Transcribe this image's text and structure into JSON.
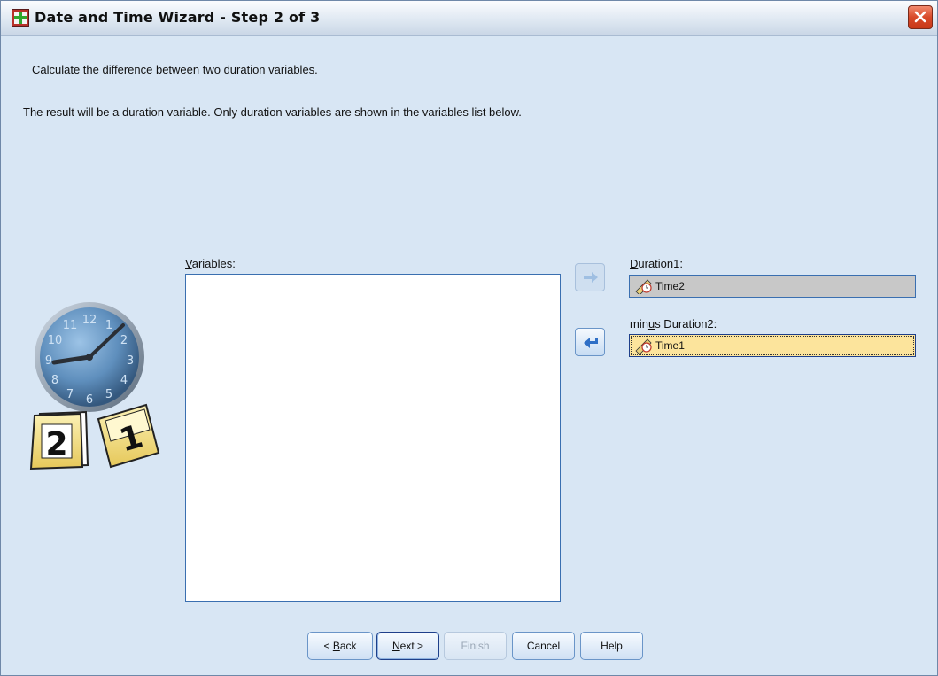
{
  "window": {
    "title": "Date and Time Wizard - Step 2 of 3"
  },
  "instructions": {
    "line1": "Calculate the difference between two duration variables.",
    "line2": "The result will be a duration variable. Only duration variables are shown in the variables list below."
  },
  "variables": {
    "label_mnemonic": "V",
    "label_rest": "ariables:",
    "items": []
  },
  "duration1": {
    "label_mnemonic": "D",
    "label_rest": "uration1:",
    "value": "Time2",
    "icon": "duration-ruler-clock-icon"
  },
  "duration2": {
    "label_pre": "min",
    "label_mnemonic": "u",
    "label_rest": "s Duration2:",
    "value": "Time1",
    "icon": "duration-ruler-clock-icon"
  },
  "buttons": {
    "back": {
      "pre": "< ",
      "mnemonic": "B",
      "rest": "ack"
    },
    "next": {
      "mnemonic": "N",
      "rest": "ext >"
    },
    "finish": "Finish",
    "cancel": "Cancel",
    "help": "Help"
  },
  "illustration": {
    "clock_numbers": [
      "12",
      "1",
      "2",
      "3",
      "4",
      "5",
      "6",
      "7",
      "8",
      "9",
      "10",
      "11"
    ],
    "calendar_left": "2",
    "calendar_right": "1"
  },
  "colors": {
    "dialog_bg": "#d8e6f4",
    "duration1_bg": "#c8c8c8",
    "duration2_bg": "#fce49c",
    "arrow_blue": "#2f6fc6",
    "close_red": "#d84a2a"
  }
}
